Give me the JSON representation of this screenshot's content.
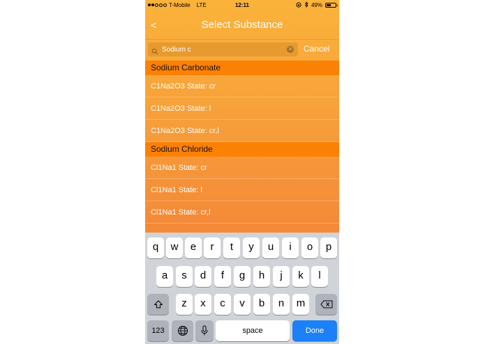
{
  "status_bar": {
    "carrier": "T-Mobile",
    "network": "LTE",
    "time": "12:11",
    "battery": "49%",
    "battery_level": 0.49
  },
  "nav": {
    "back_label": "<",
    "title": "Select Substance"
  },
  "search": {
    "value": "Sodium c",
    "cancel_label": "Cancel"
  },
  "sections": [
    {
      "title": "Sodium Carbonate",
      "rows": [
        "C1Na2O3 State: cr",
        "C1Na2O3 State: l",
        "C1Na2O3 State: cr,l"
      ]
    },
    {
      "title": "Sodium Chloride",
      "rows": [
        "Cl1Na1 State: cr",
        "Cl1Na1 State: l",
        "Cl1Na1 State: cr,l"
      ]
    }
  ],
  "keyboard": {
    "row1": [
      "q",
      "w",
      "e",
      "r",
      "t",
      "y",
      "u",
      "i",
      "o",
      "p"
    ],
    "row2": [
      "a",
      "s",
      "d",
      "f",
      "g",
      "h",
      "j",
      "k",
      "l"
    ],
    "row3": [
      "z",
      "x",
      "c",
      "v",
      "b",
      "n",
      "m"
    ],
    "numbers_label": "123",
    "space_label": "space",
    "done_label": "Done"
  },
  "colors": {
    "accent": "#fb8105",
    "done_blue": "#1c80f8"
  }
}
